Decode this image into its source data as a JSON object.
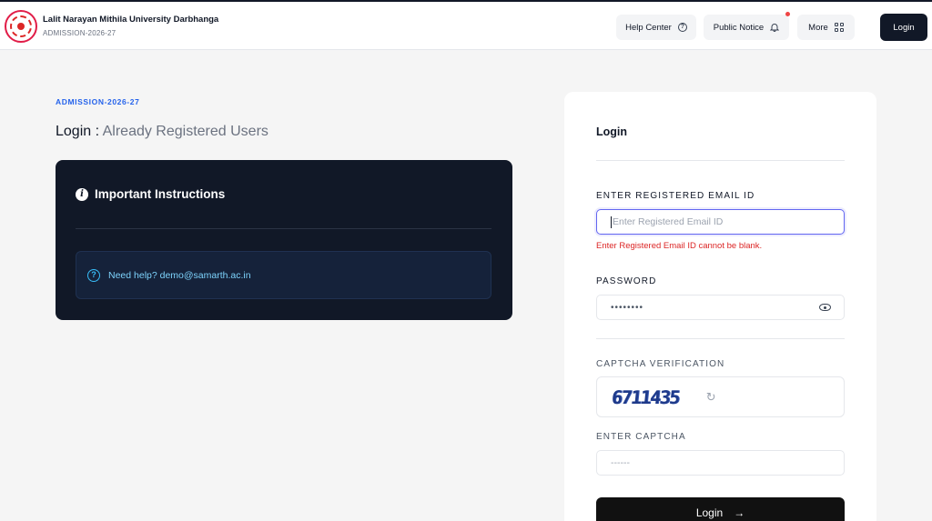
{
  "header": {
    "title": "Lalit Narayan Mithila University Darbhanga",
    "subtitle": "ADMISSION-2026-27",
    "nav": {
      "help_center": "Help Center",
      "public_notice": "Public Notice",
      "more": "More"
    },
    "login_button": "Login"
  },
  "main": {
    "section_label": "ADMISSION-2026-27",
    "heading_primary": "Login :",
    "heading_secondary": "Already Registered Users",
    "instructions": {
      "title": "Important Instructions",
      "help_text": "Need help? demo@samarth.ac.in"
    }
  },
  "login_card": {
    "title": "Login",
    "email": {
      "label": "ENTER REGISTERED EMAIL ID",
      "placeholder": "Enter Registered Email ID",
      "error": "Enter Registered Email ID cannot be blank."
    },
    "password": {
      "label": "PASSWORD",
      "value": "••••••••"
    },
    "captcha": {
      "label": "CAPTCHA VERIFICATION",
      "image_text": "6711435"
    },
    "enter_captcha": {
      "label": "ENTER CAPTCHA",
      "placeholder": "------"
    },
    "submit_label": "Login",
    "submit_icon": "→"
  },
  "colors": {
    "accent": "#2563eb",
    "dark_panel": "#111827",
    "error": "#dc2626",
    "focus": "#6366f1"
  }
}
